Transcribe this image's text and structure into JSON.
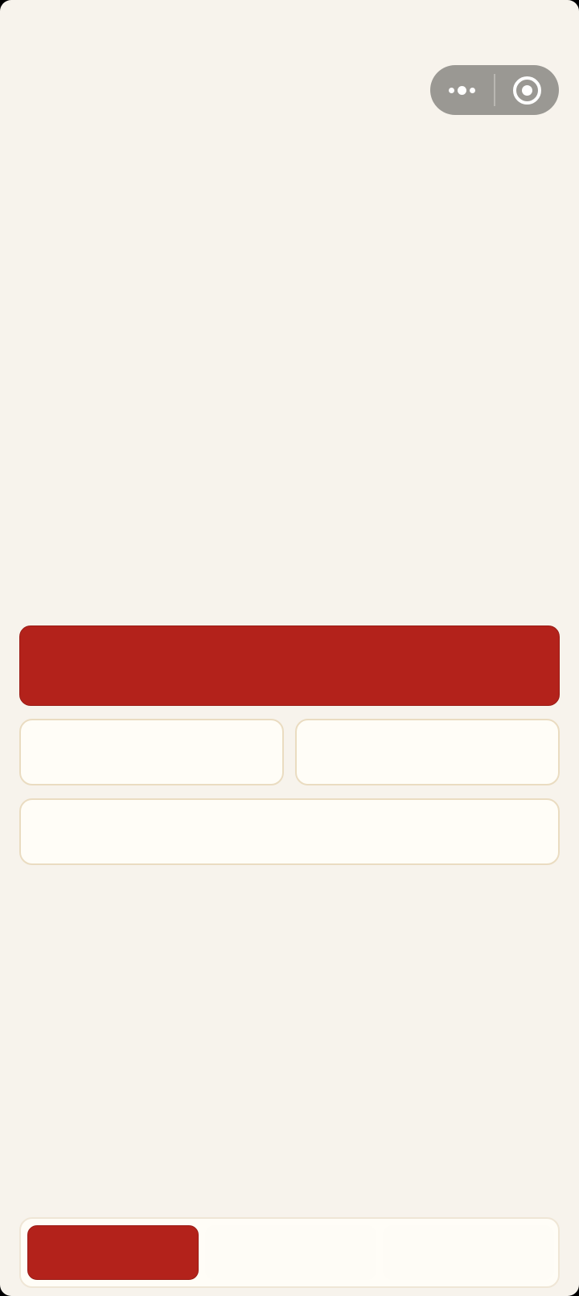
{
  "theme": {
    "background": "#f7f3ec",
    "accent": "#b3221b",
    "card_background": "#fffdf7",
    "card_border": "#eadcc1",
    "capsule_background": "#9a9893"
  },
  "capsule": {
    "more_icon": "more-dots-icon",
    "close_icon": "target-circle-icon"
  },
  "main": {
    "primary_button_label": "",
    "card_left_label": "",
    "card_right_label": "",
    "card_wide_label": ""
  },
  "tabbar": {
    "active_index": 0,
    "tabs": [
      {
        "label": ""
      },
      {
        "label": ""
      },
      {
        "label": ""
      }
    ]
  }
}
